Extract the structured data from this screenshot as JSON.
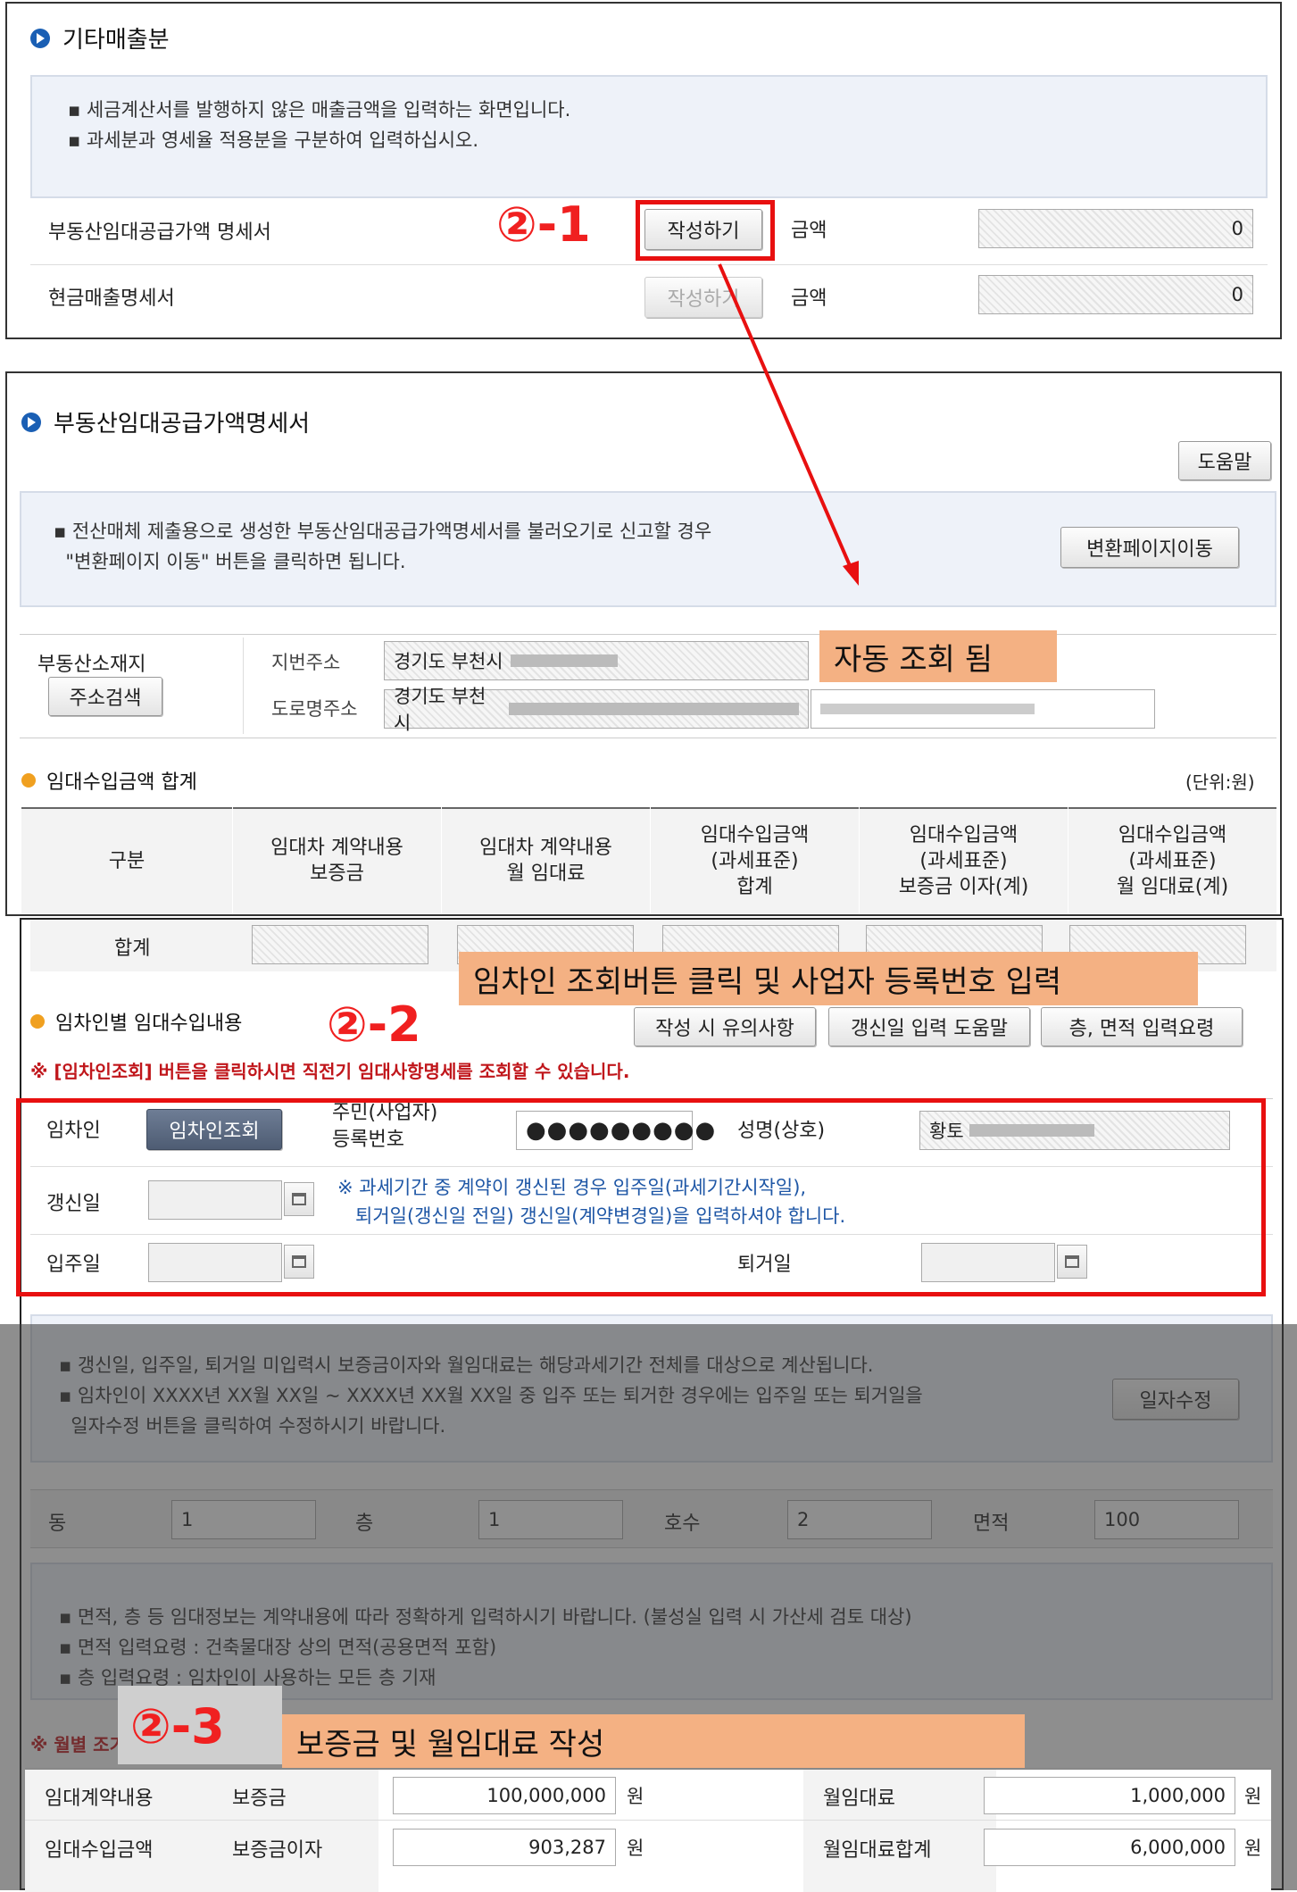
{
  "panel1": {
    "title": "기타매출분",
    "notes": [
      "세금계산서를 발행하지 않은 매출금액을 입력하는 화면입니다.",
      "과세분과 영세율 적용분을 구분하여 입력하십시오."
    ],
    "rows": [
      {
        "label": "부동산임대공급가액 명세서",
        "button": "작성하기",
        "amount_label": "금액",
        "amount": "0"
      },
      {
        "label": "현금매출명세서",
        "button": "작성하기",
        "amount_label": "금액",
        "amount": "0"
      }
    ],
    "marker": "②-1"
  },
  "panel2": {
    "title": "부동산임대공급가액명세서",
    "help_button": "도움말",
    "note_line1": "전산매체 제출용으로 생성한 부동산임대공급가액명세서를 불러오기로 신고할 경우",
    "note_line2": "\"변환페이지 이동\" 버튼을 클릭하면 됩니다.",
    "convert_button": "변환페이지이동",
    "location_label": "부동산소재지",
    "address_search_button": "주소검색",
    "jibun_label": "지번주소",
    "jibun_value": "경기도 부천시",
    "road_label": "도로명주소",
    "road_value": "경기도 부천시",
    "auto_annotation": "자동 조회 됨",
    "sum_title": "임대수입금액 합계",
    "unit": "(단위:원)",
    "headers": [
      [
        "구분"
      ],
      [
        "임대차 계약내용",
        "보증금"
      ],
      [
        "임대차 계약내용",
        "월 임대료"
      ],
      [
        "임대수입금액",
        "(과세표준)",
        "합계"
      ],
      [
        "임대수입금액",
        "(과세표준)",
        "보증금 이자(계)"
      ],
      [
        "임대수입금액",
        "(과세표준)",
        "월 임대료(계)"
      ]
    ]
  },
  "panel3": {
    "total_label": "합계",
    "tenant_annotation": "임차인 조회버튼 클릭 및 사업자 등록번호 입력",
    "marker2": "②-2",
    "section_title": "임차인별 임대수입내용",
    "buttons": [
      "작성 시 유의사항",
      "갱신일 입력 도움말",
      "층, 면적 입력요령"
    ],
    "red_notice": "※ [임차인조회] 버튼을 클릭하시면 직전기 임대사항명세를 조회할 수 있습니다.",
    "tenant_label": "임차인",
    "tenant_lookup_button": "임차인조회",
    "reg_no_label_1": "주민(사업자)",
    "reg_no_label_2": "등록번호",
    "reg_no_value": "●●●●●●●●●",
    "name_label": "성명(상호)",
    "name_value": "황토",
    "renewal_label": "갱신일",
    "renewal_note_1": "※ 과세기간 중 계약이 갱신된 경우 입주일(과세기간시작일),",
    "renewal_note_2": "퇴거일(갱신일 전일) 갱신일(계약변경일)을 입력하셔야 합니다.",
    "movein_label": "입주일",
    "moveout_label": "퇴거일",
    "info_notes": [
      "갱신일, 입주일, 퇴거일 미입력시 보증금이자와 월임대료는 해당과세기간 전체를 대상으로 계산됩니다.",
      "임차인이 XXXX년 XX월 XX일 ~ XXXX년 XX월 XX일 중 입주 또는 퇴거한 경우에는 입주일 또는 퇴거일을",
      "일자수정 버튼을 클릭하여 수정하시기 바랍니다."
    ],
    "date_edit_button": "일자수정",
    "dong_label": "동",
    "dong_value": "1",
    "floor_label": "층",
    "floor_value": "1",
    "ho_label": "호수",
    "ho_value": "2",
    "area_label": "면적",
    "area_value": "100",
    "area_notes": [
      "면적, 층 등 임대정보는 계약내용에 따라 정확하게 입력하시기 바랍니다. (불성실 입력 시 가산세 검토 대상)",
      "면적 입력요령 : 건축물대장 상의 면적(공용면적 포함)",
      "층 입력요령 : 임차인이 사용하는 모든 층 기재"
    ],
    "monthly_notice": "※ 월별 조기환급신고하는",
    "marker3": "②-3",
    "deposit_annotation": "보증금 및 월임대료 작성",
    "contract_label": "임대계약내용",
    "deposit_label": "보증금",
    "deposit_value": "100,000,000",
    "monthly_rent_label": "월임대료",
    "monthly_rent_value": "1,000,000",
    "income_label": "임대수입금액",
    "deposit_interest_label": "보증금이자",
    "deposit_interest_value": "903,287",
    "monthly_total_label": "월임대료합계",
    "monthly_total_value": "6,000,000",
    "won": "원"
  }
}
